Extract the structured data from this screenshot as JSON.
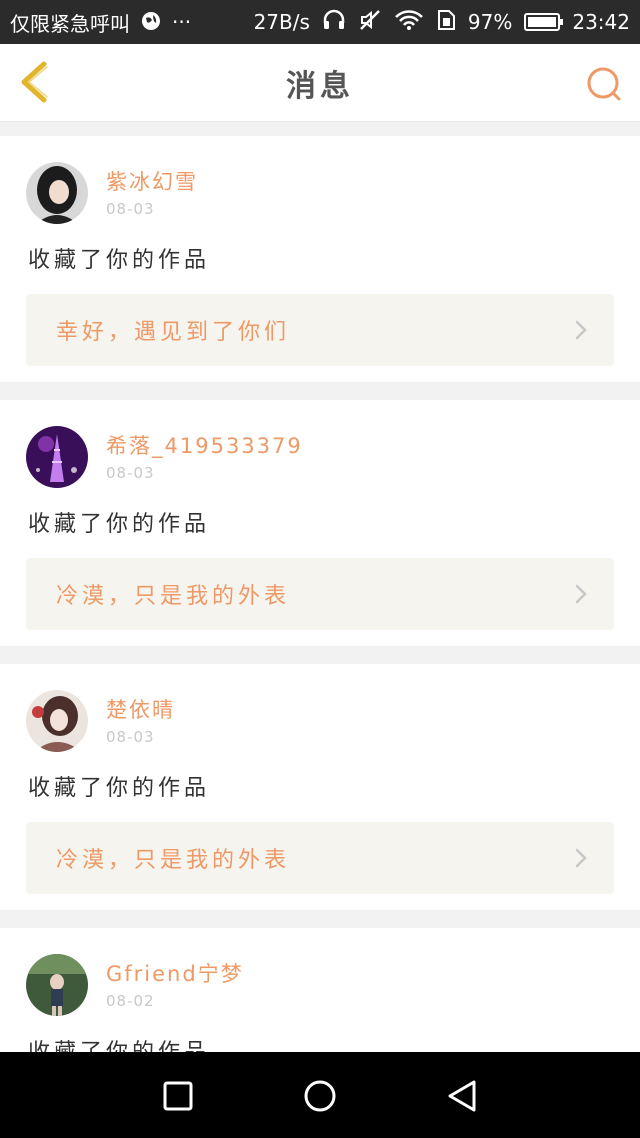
{
  "status_bar": {
    "carrier": "仅限紧急呼叫",
    "overflow": "···",
    "speed": "27B/s",
    "battery": "97%",
    "battery_level": 0.97,
    "time": "23:42"
  },
  "header": {
    "title": "消息",
    "back_icon": "chevron-left-icon",
    "search_icon": "search-icon"
  },
  "colors": {
    "accent": "#ee9966",
    "back_arrow": "#e2b62c",
    "status_bar_bg": "#2b2b2b",
    "link_bg": "#f5f4ee"
  },
  "feed": [
    {
      "user": "紫冰幻雪",
      "date": "08-03",
      "action": "收藏了你的作品",
      "work_title": "幸好，遇见到了你们"
    },
    {
      "user": "希落_419533379",
      "date": "08-03",
      "action": "收藏了你的作品",
      "work_title": "冷漠，只是我的外表"
    },
    {
      "user": "楚依晴",
      "date": "08-03",
      "action": "收藏了你的作品",
      "work_title": "冷漠，只是我的外表"
    },
    {
      "user": "Gfriend宁梦",
      "date": "08-02",
      "action": "收藏了你的作品",
      "work_title": ""
    }
  ],
  "nav": {
    "recents_icon": "square-icon",
    "home_icon": "circle-icon",
    "back_icon": "triangle-back-icon"
  }
}
